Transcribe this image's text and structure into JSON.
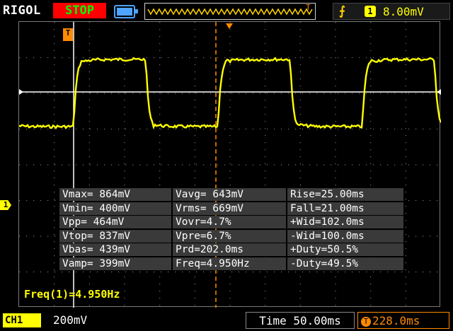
{
  "top_bar": {
    "brand": "RIGOL",
    "run_state": "STOP",
    "trigger_source": "1",
    "trigger_level": "8.00mV"
  },
  "channel_marker": "1",
  "trigger_position_marker": "T",
  "measurements": [
    [
      "Vmax= 864mV",
      "Vavg= 643mV",
      "Rise=25.00ms"
    ],
    [
      "Vmin= 400mV",
      "Vrms= 669mV",
      "Fall=21.00ms"
    ],
    [
      "Vpp= 464mV",
      "Vovr=4.7%",
      "+Wid=102.0ms"
    ],
    [
      "Vtop= 837mV",
      "Vpre=6.7%",
      "-Wid=100.0ms"
    ],
    [
      "Vbas= 439mV",
      "Prd=202.0ms",
      "+Duty=50.5%"
    ],
    [
      "Vamp= 399mV",
      "Freq=4.950Hz",
      "-Duty=49.5%"
    ]
  ],
  "frequency_readout": "Freq(1)=4.950Hz",
  "bottom_bar": {
    "channel_label": "CH1",
    "vertical_scale": "200mV",
    "timebase": "Time 50.00ms",
    "trigger_offset": "228.0ms",
    "trigger_offset_icon": "T"
  },
  "colors": {
    "trace": "#ffff00",
    "run_state_bg": "#ff0000",
    "run_state_text": "#00ff00",
    "trigger": "#ff8a00",
    "cursor": "#ffffff"
  }
}
